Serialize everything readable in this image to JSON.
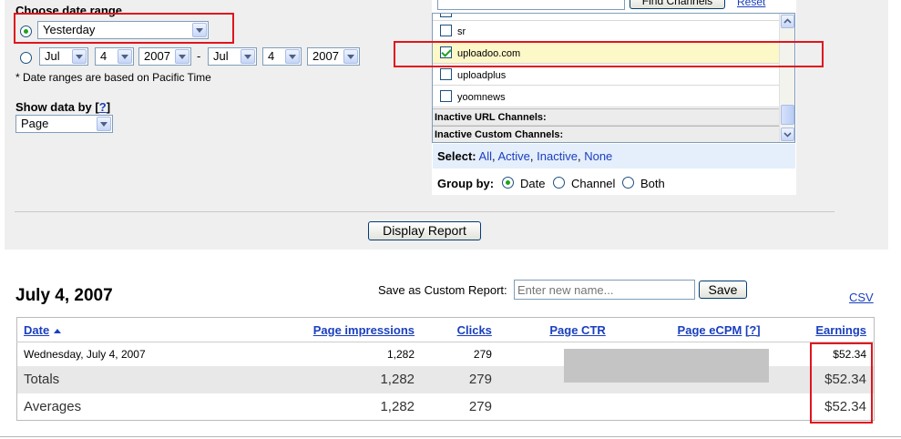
{
  "date_range": {
    "title": "Choose date range",
    "preset_value": "Yesterday",
    "from_month": "Jul",
    "from_day": "4",
    "from_year": "2007",
    "separator": "-",
    "to_month": "Jul",
    "to_day": "4",
    "to_year": "2007",
    "note": "* Date ranges are based on Pacific Time"
  },
  "show_data_by": {
    "label": "Show data by",
    "help": "?",
    "value": "Page"
  },
  "channels": {
    "find_button": "Find Channels",
    "reset_link": "Reset",
    "items": [
      {
        "label": "sr",
        "checked": false
      },
      {
        "label": "uploadoo.com",
        "checked": true
      },
      {
        "label": "uploadplus",
        "checked": false
      },
      {
        "label": "yoomnews",
        "checked": false
      }
    ],
    "inactive_url": "Inactive URL Channels:",
    "inactive_custom": "Inactive Custom Channels:",
    "select_label": "Select:",
    "select_all": "All",
    "select_active": "Active",
    "select_inactive": "Inactive",
    "select_none": "None",
    "group_by_label": "Group by:",
    "group_date": "Date",
    "group_channel": "Channel",
    "group_both": "Both"
  },
  "display_report_button": "Display Report",
  "report": {
    "title": "July 4, 2007",
    "save_label": "Save as Custom Report:",
    "save_placeholder": "Enter new name...",
    "save_button": "Save",
    "csv_link": "CSV",
    "columns": {
      "date": "Date",
      "impressions": "Page impressions",
      "clicks": "Clicks",
      "ctr": "Page CTR",
      "ecpm": "Page eCPM",
      "ecpm_help": "[?]",
      "earnings": "Earnings"
    },
    "rows": [
      {
        "date": "Wednesday, July 4, 2007",
        "impressions": "1,282",
        "clicks": "279",
        "earnings": "$52.34"
      },
      {
        "date": "Totals",
        "impressions": "1,282",
        "clicks": "279",
        "earnings": "$52.34"
      },
      {
        "date": "Averages",
        "impressions": "1,282",
        "clicks": "279",
        "earnings": "$52.34"
      }
    ]
  },
  "colors": {
    "highlight_red": "#e0141e",
    "link_blue": "#1a3fbf",
    "panel_gray": "#efefef",
    "selected_row": "#fcf8c8"
  }
}
